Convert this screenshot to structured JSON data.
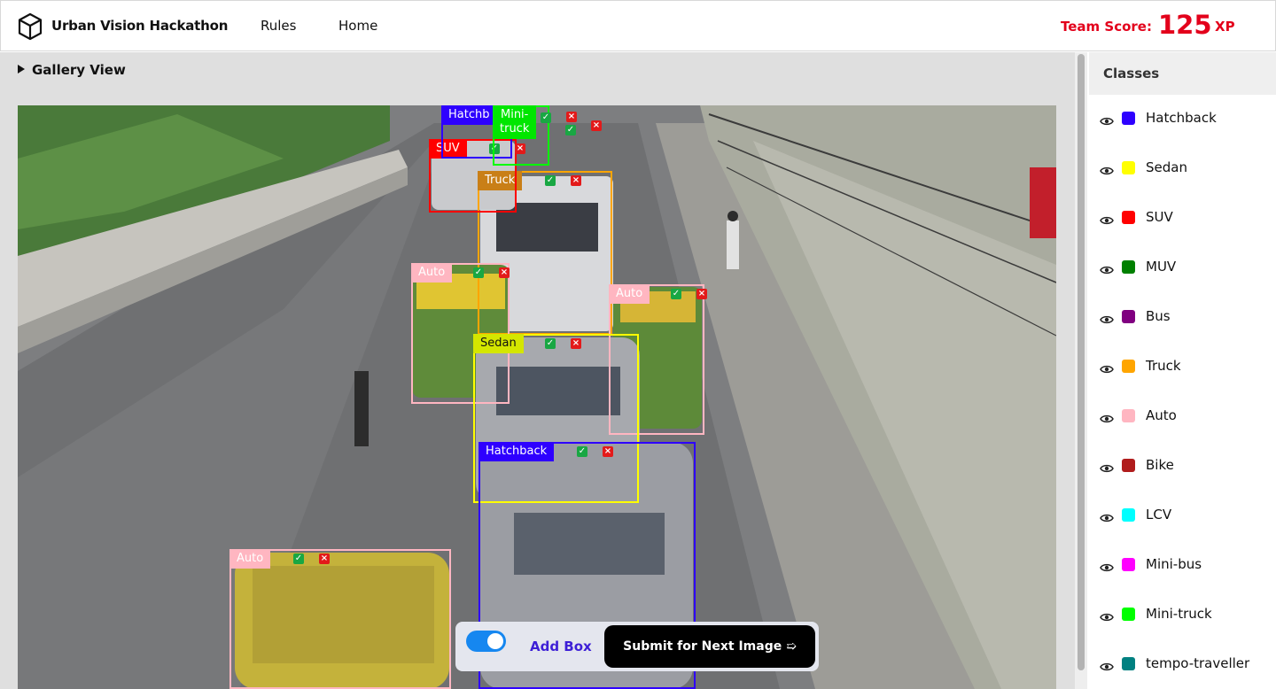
{
  "header": {
    "app_title": "Urban Vision Hackathon",
    "nav": {
      "rules": "Rules",
      "home": "Home"
    },
    "score_label": "Team Score:",
    "score_value": "125",
    "score_unit": "XP",
    "score_color": "#e3001b"
  },
  "gallery": {
    "toggle_label": "Gallery View"
  },
  "annotations": [
    {
      "label": "Hatchback",
      "display": "Hatchb",
      "color": "#2e00ff"
    },
    {
      "label": "Mini-truck",
      "display": "Mini-\ntruck",
      "color": "#00ff00"
    },
    {
      "label": "SUV",
      "display": "SUV",
      "color": "#ff0000"
    },
    {
      "label": "Truck",
      "display": "Truck",
      "color": "#ffa500"
    },
    {
      "label": "Auto",
      "display": "Auto",
      "color": "#ffb6c1"
    },
    {
      "label": "Auto",
      "display": "Auto",
      "color": "#ffb6c1"
    },
    {
      "label": "Sedan",
      "display": "Sedan",
      "color": "#ffff00"
    },
    {
      "label": "Hatchback",
      "display": "Hatchback",
      "color": "#2e00ff"
    },
    {
      "label": "Auto",
      "display": "Auto",
      "color": "#ffb6c1"
    }
  ],
  "toolbar": {
    "toggle_on": true,
    "add_box_label": "Add Box",
    "submit_label": "Submit for Next Image ➯"
  },
  "sidebar": {
    "title": "Classes",
    "classes": [
      {
        "name": "Hatchback",
        "color": "#2e00ff",
        "icon": "eye-icon"
      },
      {
        "name": "Sedan",
        "color": "#ffff00",
        "icon": "eye-icon"
      },
      {
        "name": "SUV",
        "color": "#ff0000",
        "icon": "eye-icon"
      },
      {
        "name": "MUV",
        "color": "#008000",
        "icon": "eye-icon"
      },
      {
        "name": "Bus",
        "color": "#800080",
        "icon": "eye-icon"
      },
      {
        "name": "Truck",
        "color": "#ffa500",
        "icon": "eye-icon"
      },
      {
        "name": "Auto",
        "color": "#ffb6c1",
        "icon": "eye-icon"
      },
      {
        "name": "Bike",
        "color": "#b01c1c",
        "icon": "eye-icon"
      },
      {
        "name": "LCV",
        "color": "#00ffff",
        "icon": "eye-icon"
      },
      {
        "name": "Mini-bus",
        "color": "#ff00ff",
        "icon": "eye-icon"
      },
      {
        "name": "Mini-truck",
        "color": "#00ff00",
        "icon": "eye-icon"
      },
      {
        "name": "tempo-traveller",
        "color": "#008080",
        "icon": "eye-icon"
      }
    ]
  }
}
